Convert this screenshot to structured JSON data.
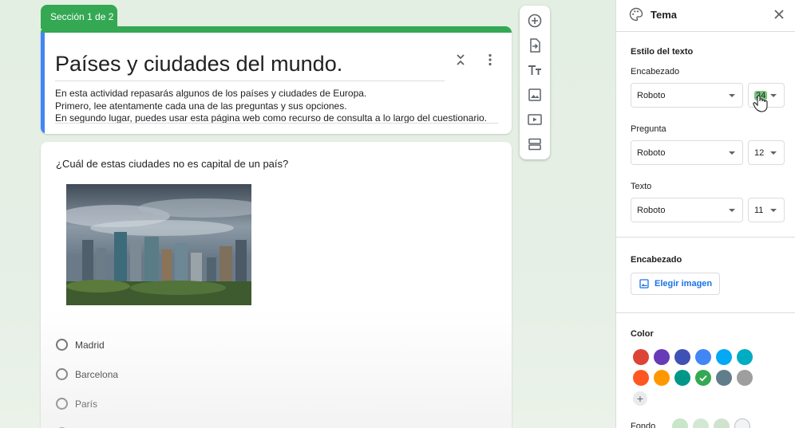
{
  "form": {
    "section_tab": "Sección 1 de 2",
    "title": "Países y ciudades del mundo.",
    "description_lines": [
      "En esta actividad repasarás algunos de los países y ciudades de Europa.",
      "Primero, lee atentamente cada una de las preguntas y sus opciones.",
      "En segundo lugar, puedes usar esta página web como recurso de consulta a lo largo del cuestionario."
    ],
    "question": {
      "text": "¿Cuál de estas ciudades no es capital de un país?",
      "options": [
        "Madrid",
        "Barcelona",
        "París"
      ]
    }
  },
  "toolbar": {
    "icons": [
      "add-question-icon",
      "import-questions-icon",
      "add-title-icon",
      "add-image-icon",
      "add-video-icon",
      "add-section-icon"
    ]
  },
  "theme_panel": {
    "title": "Tema",
    "text_style_heading": "Estilo del texto",
    "header_label": "Encabezado",
    "header_font": "Roboto",
    "header_size": "24",
    "question_label": "Pregunta",
    "question_font": "Roboto",
    "question_size": "12",
    "text_label": "Texto",
    "text_font": "Roboto",
    "text_size": "11",
    "header_section_heading": "Encabezado",
    "choose_image_label": "Elegir imagen",
    "color_heading": "Color",
    "background_label": "Fondo",
    "colors": [
      "#db4437",
      "#673ab7",
      "#3f51b5",
      "#4285f4",
      "#03a9f4",
      "#00acc1",
      "#ff5722",
      "#ff9800",
      "#009688",
      "#34a853",
      "#607d8b",
      "#9e9e9e"
    ],
    "selected_color": "#34a853",
    "background_colors": [
      "#c8e6c9",
      "#d3e8d3",
      "#cfe3cf",
      "#f1f3f4"
    ]
  }
}
